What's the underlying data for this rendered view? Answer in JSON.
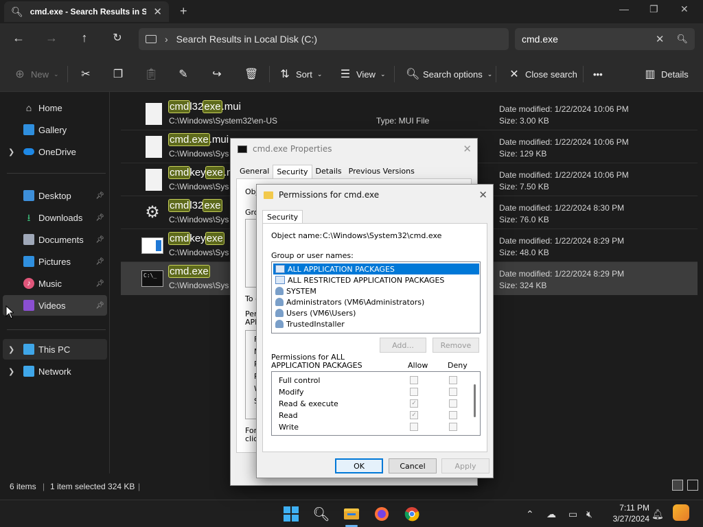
{
  "tab": {
    "title": "cmd.exe - Search Results in Sy"
  },
  "address": {
    "path": "Search Results in Local Disk (C:)"
  },
  "search": {
    "value": "cmd.exe"
  },
  "toolbar": {
    "new": "New",
    "sort": "Sort",
    "view": "View",
    "search_options": "Search options",
    "close_search": "Close search",
    "details": "Details"
  },
  "sidebar": {
    "home": "Home",
    "gallery": "Gallery",
    "onedrive": "OneDrive",
    "desktop": "Desktop",
    "downloads": "Downloads",
    "documents": "Documents",
    "pictures": "Pictures",
    "music": "Music",
    "videos": "Videos",
    "this_pc": "This PC",
    "network": "Network"
  },
  "files": [
    {
      "name_pre": "",
      "hl1": "cmd",
      "mid": "l32",
      "hl2": "exe",
      "post": ".mui",
      "path": "C:\\Windows\\System32\\en-US",
      "type": "Type: MUI File",
      "date": "Date modified: 1/22/2024 10:06 PM",
      "size": "Size: 3.00 KB"
    },
    {
      "hl1": "cmd.exe",
      "post": ".mui",
      "path": "C:\\Windows\\Sys",
      "date": "Date modified: 1/22/2024 10:06 PM",
      "size": "Size: 129 KB"
    },
    {
      "hl1": "cmd",
      "mid": "key",
      "hl2": "exe",
      "post": ".m",
      "path": "C:\\Windows\\Sys",
      "date": "Date modified: 1/22/2024 10:06 PM",
      "size": "Size: 7.50 KB"
    },
    {
      "hl1": "cmd",
      "mid": "l32",
      "hl2": "exe",
      "path": "C:\\Windows\\Sys",
      "date": "Date modified: 1/22/2024 8:30 PM",
      "size": "Size: 76.0 KB"
    },
    {
      "hl1": "cmd",
      "mid": "key",
      "hl2": "exe",
      "path": "C:\\Windows\\Sys",
      "date": "Date modified: 1/22/2024 8:29 PM",
      "size": "Size: 48.0 KB"
    },
    {
      "hl1": "cmd.exe",
      "path": "C:\\Windows\\Sys",
      "date": "Date modified: 1/22/2024 8:29 PM",
      "size": "Size: 324 KB"
    }
  ],
  "status": {
    "items": "6 items",
    "selected": "1 item selected  324 KB"
  },
  "clock": {
    "time": "7:11 PM",
    "date": "3/27/2024"
  },
  "props": {
    "title": "cmd.exe Properties",
    "tabs": [
      "General",
      "Security",
      "Details",
      "Previous Versions"
    ],
    "obj_label": "Obje",
    "grp_label": "Grou",
    "to_c": "To c",
    "perm_prefix": "Perm",
    "appl": "APPL",
    "perm_letters": [
      "F",
      "M",
      "R",
      "R",
      "W",
      "S"
    ],
    "for_frag": "For",
    "click_frag": "click"
  },
  "perm": {
    "title": "Permissions for cmd.exe",
    "tab": "Security",
    "object_label": "Object name:",
    "object_value": "C:\\Windows\\System32\\cmd.exe",
    "group_label": "Group or user names:",
    "groups": [
      "ALL APPLICATION PACKAGES",
      "ALL RESTRICTED APPLICATION PACKAGES",
      "SYSTEM",
      "Administrators (VM6\\Administrators)",
      "Users (VM6\\Users)",
      "TrustedInstaller"
    ],
    "add": "Add...",
    "remove": "Remove",
    "perms_for_line1": "Permissions for ALL",
    "perms_for_line2": "APPLICATION PACKAGES",
    "allow": "Allow",
    "deny": "Deny",
    "permissions": [
      {
        "name": "Full control",
        "allow": false,
        "deny": false
      },
      {
        "name": "Modify",
        "allow": false,
        "deny": false
      },
      {
        "name": "Read & execute",
        "allow": true,
        "deny": false
      },
      {
        "name": "Read",
        "allow": true,
        "deny": false
      },
      {
        "name": "Write",
        "allow": false,
        "deny": false
      }
    ],
    "ok": "OK",
    "cancel": "Cancel",
    "apply": "Apply"
  }
}
